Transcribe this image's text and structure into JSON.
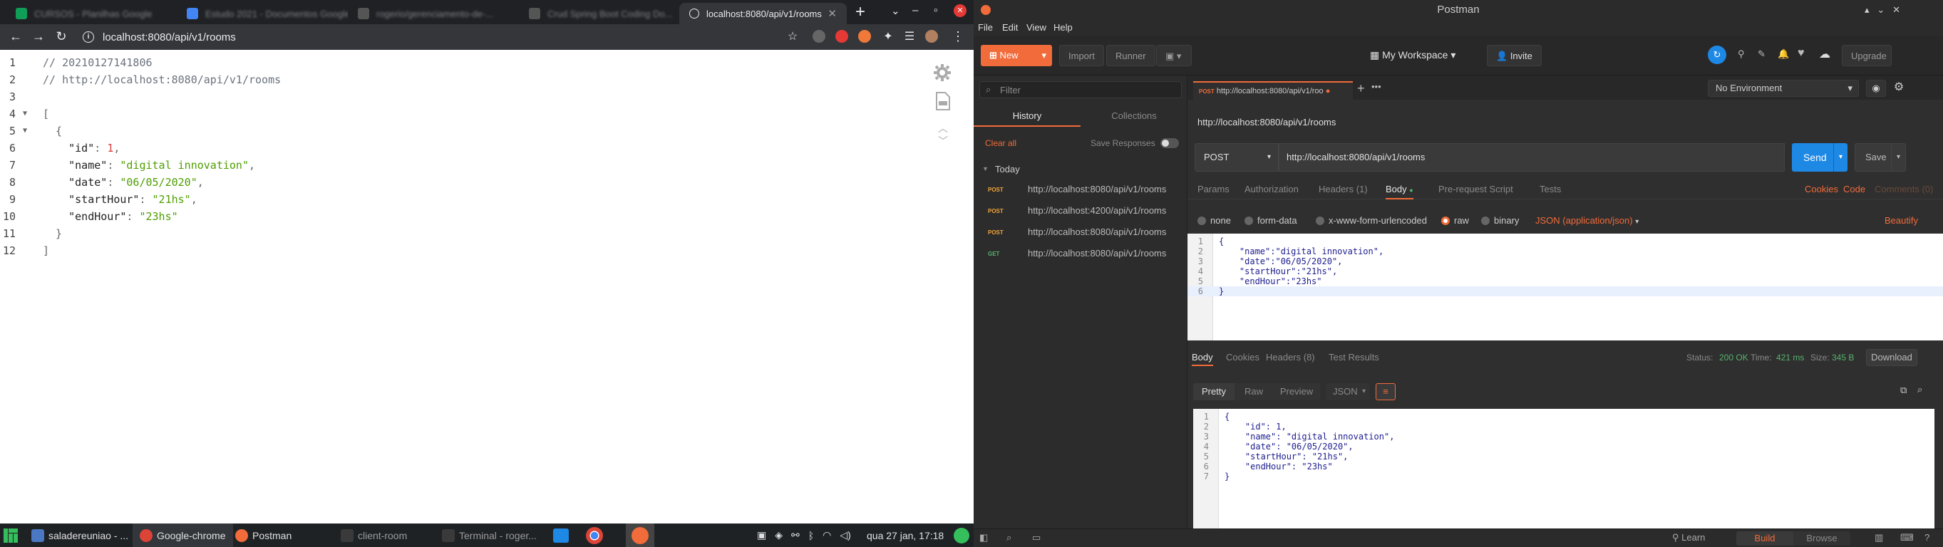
{
  "chrome": {
    "tabs": [
      {
        "label": "CURSOS - Planilhas Google",
        "favicon_color": "#0f9d58"
      },
      {
        "label": "Estudo 2021 - Documentos Google",
        "favicon_color": "#4285f4"
      },
      {
        "label": "rogerio/gerenciamento-de-...",
        "favicon_color": "#555555"
      },
      {
        "label": "Crud Spring Boot Coding Do...",
        "favicon_color": "#555555"
      },
      {
        "label": "localhost:8080/api/v1/rooms",
        "favicon_color": "#9aa0a6"
      }
    ],
    "new_tab_glyph": "+",
    "window_buttons": [
      "⌄",
      "–",
      "▫",
      "✕"
    ],
    "url": "localhost:8080/api/v1/rooms",
    "json_lines": [
      {
        "num": "1",
        "fold": "",
        "parts": [
          {
            "t": "// 20210127141806",
            "c": "cm"
          }
        ]
      },
      {
        "num": "2",
        "fold": "",
        "parts": [
          {
            "t": "// http://localhost:8080/api/v1/rooms",
            "c": "cm"
          }
        ]
      },
      {
        "num": "3",
        "fold": "",
        "parts": []
      },
      {
        "num": "4",
        "fold": "▼",
        "parts": [
          {
            "t": "[",
            "c": "pn"
          }
        ]
      },
      {
        "num": "5",
        "fold": "▼",
        "parts": [
          {
            "t": "  {",
            "c": "pn"
          }
        ]
      },
      {
        "num": "6",
        "fold": "",
        "parts": [
          {
            "t": "    \"id\"",
            "c": "ky"
          },
          {
            "t": ": ",
            "c": "pn"
          },
          {
            "t": "1",
            "c": "nm"
          },
          {
            "t": ",",
            "c": "pn"
          }
        ]
      },
      {
        "num": "7",
        "fold": "",
        "parts": [
          {
            "t": "    \"name\"",
            "c": "ky"
          },
          {
            "t": ": ",
            "c": "pn"
          },
          {
            "t": "\"digital innovation\"",
            "c": "st"
          },
          {
            "t": ",",
            "c": "pn"
          }
        ]
      },
      {
        "num": "8",
        "fold": "",
        "parts": [
          {
            "t": "    \"date\"",
            "c": "ky"
          },
          {
            "t": ": ",
            "c": "pn"
          },
          {
            "t": "\"06/05/2020\"",
            "c": "st"
          },
          {
            "t": ",",
            "c": "pn"
          }
        ]
      },
      {
        "num": "9",
        "fold": "",
        "parts": [
          {
            "t": "    \"startHour\"",
            "c": "ky"
          },
          {
            "t": ": ",
            "c": "pn"
          },
          {
            "t": "\"21hs\"",
            "c": "st"
          },
          {
            "t": ",",
            "c": "pn"
          }
        ]
      },
      {
        "num": "10",
        "fold": "",
        "parts": [
          {
            "t": "    \"endHour\"",
            "c": "ky"
          },
          {
            "t": ": ",
            "c": "pn"
          },
          {
            "t": "\"23hs\"",
            "c": "st"
          }
        ]
      },
      {
        "num": "11",
        "fold": "",
        "parts": [
          {
            "t": "  }",
            "c": "pn"
          }
        ]
      },
      {
        "num": "12",
        "fold": "",
        "parts": [
          {
            "t": "]",
            "c": "pn"
          }
        ]
      }
    ]
  },
  "taskbar": {
    "items": [
      {
        "label": "saladereuniao - ...",
        "icon_color": "#4a78c2",
        "dim": false
      },
      {
        "label": "Google-chrome",
        "icon_color": "#db4437",
        "dim": false
      },
      {
        "label": "Postman",
        "icon_color": "#f26b3a",
        "dim": false
      },
      {
        "label": "client-room",
        "icon_color": "#3a3a3a",
        "dim": true
      },
      {
        "label": "Terminal - roger...",
        "icon_color": "#3a3a3a",
        "dim": true
      }
    ],
    "clock": "qua 27 jan, 17:18"
  },
  "postman": {
    "title": "Postman",
    "menu": [
      "File",
      "Edit",
      "View",
      "Help"
    ],
    "header": {
      "new": "New",
      "import": "Import",
      "runner": "Runner",
      "workspace": "My Workspace",
      "invite": "Invite",
      "upgrade": "Upgrade"
    },
    "sidebar": {
      "filter_placeholder": "Filter",
      "tab_history": "History",
      "tab_collections": "Collections",
      "clear_all": "Clear all",
      "save_responses": "Save Responses",
      "group": "Today",
      "history": [
        {
          "method": "POST",
          "url": "http://localhost:8080/api/v1/rooms"
        },
        {
          "method": "POST",
          "url": "http://localhost:4200/api/v1/rooms"
        },
        {
          "method": "POST",
          "url": "http://localhost:8080/api/v1/rooms"
        },
        {
          "method": "GET",
          "url": "http://localhost:8080/api/v1/rooms"
        }
      ]
    },
    "request_tab": {
      "method": "POST",
      "label": "http://localhost:8080/api/v1/roo"
    },
    "environment": "No Environment",
    "request_title": "http://localhost:8080/api/v1/rooms",
    "method": "POST",
    "url": "http://localhost:8080/api/v1/rooms",
    "send": "Send",
    "save": "Save",
    "req_tabs": [
      "Params",
      "Authorization",
      "Headers (1)",
      "Body",
      "Pre-request Script",
      "Tests"
    ],
    "req_links": [
      "Cookies",
      "Code",
      "Comments (0)"
    ],
    "body_modes": [
      "none",
      "form-data",
      "x-www-form-urlencoded",
      "raw",
      "binary"
    ],
    "body_type": "JSON (application/json)",
    "beautify": "Beautify",
    "request_body": [
      {
        "n": "1",
        "t": "{"
      },
      {
        "n": "2",
        "t": "    \"name\":\"digital innovation\","
      },
      {
        "n": "3",
        "t": "    \"date\":\"06/05/2020\","
      },
      {
        "n": "4",
        "t": "    \"startHour\":\"21hs\","
      },
      {
        "n": "5",
        "t": "    \"endHour\":\"23hs\""
      },
      {
        "n": "6",
        "t": "}"
      }
    ],
    "resp_tabs": [
      "Body",
      "Cookies",
      "Headers (8)",
      "Test Results"
    ],
    "status_label": "Status:",
    "status": "200 OK",
    "time_label": "Time:",
    "time": "421 ms",
    "size_label": "Size:",
    "size": "345 B",
    "download": "Download",
    "view_modes": [
      "Pretty",
      "Raw",
      "Preview"
    ],
    "resp_format": "JSON",
    "response_body": [
      {
        "n": "1",
        "t": "{"
      },
      {
        "n": "2",
        "t": "    \"id\": 1,"
      },
      {
        "n": "3",
        "t": "    \"name\": \"digital innovation\","
      },
      {
        "n": "4",
        "t": "    \"date\": \"06/05/2020\","
      },
      {
        "n": "5",
        "t": "    \"startHour\": \"21hs\","
      },
      {
        "n": "6",
        "t": "    \"endHour\": \"23hs\""
      },
      {
        "n": "7",
        "t": "}"
      }
    ],
    "statusbar": {
      "learn": "Learn",
      "build": "Build",
      "browse": "Browse"
    }
  }
}
